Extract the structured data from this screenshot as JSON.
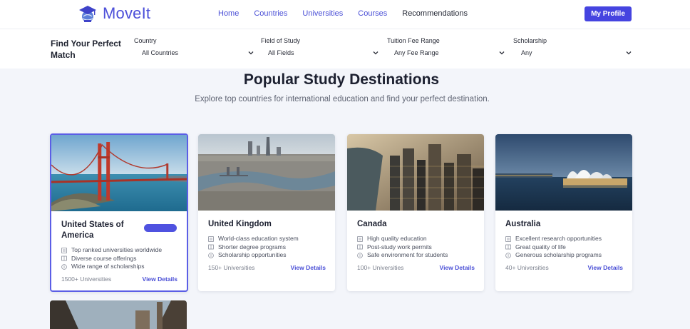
{
  "brand": {
    "name": "MoveIt",
    "accent": "#4c4fd9"
  },
  "nav": {
    "links": [
      "Home",
      "Countries",
      "Universities",
      "Courses",
      "Recommendations"
    ],
    "profile_label": "My Profile"
  },
  "filters": {
    "title": "Find Your Perfect Match",
    "fields": [
      {
        "label": "Country",
        "value": "All Countries"
      },
      {
        "label": "Field of Study",
        "value": "All Fields"
      },
      {
        "label": "Tuition Fee Range",
        "value": "Any Fee Range"
      },
      {
        "label": "Scholarship",
        "value": "Any"
      }
    ]
  },
  "hero": {
    "title": "Popular Study Destinations",
    "subtitle": "Explore top countries for international education and find your perfect destination."
  },
  "cards": [
    {
      "name": "United States of America",
      "features": [
        "Top ranked universities worldwide",
        "Diverse course offerings",
        "Wide range of scholarships"
      ],
      "count": "1500+ Universities",
      "action": "View Details",
      "selected": true
    },
    {
      "name": "United Kingdom",
      "features": [
        "World-class education system",
        "Shorter degree programs",
        "Scholarship opportunities"
      ],
      "count": "150+ Universities",
      "action": "View Details"
    },
    {
      "name": "Canada",
      "features": [
        "High quality education",
        "Post-study work permits",
        "Safe environment for students"
      ],
      "count": "100+ Universities",
      "action": "View Details"
    },
    {
      "name": "Australia",
      "features": [
        "Excellent research opportunities",
        "Great quality of life",
        "Generous scholarship programs"
      ],
      "count": "40+ Universities",
      "action": "View Details"
    }
  ]
}
